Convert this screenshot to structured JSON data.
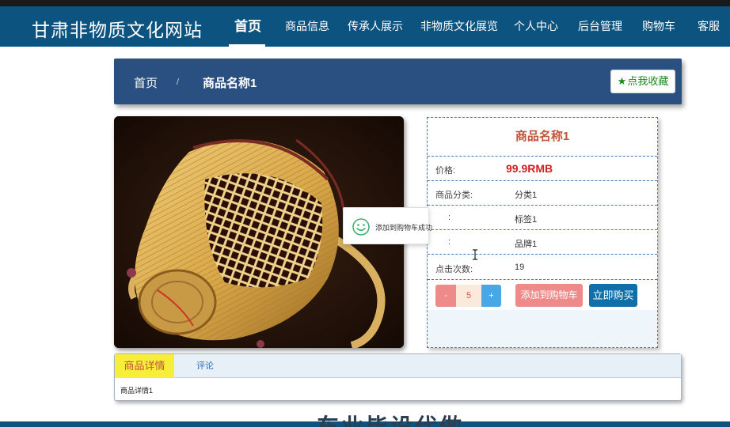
{
  "site": {
    "title": "甘肃非物质文化网站"
  },
  "nav": {
    "items": [
      {
        "label": "首页",
        "active": true
      },
      {
        "label": "商品信息"
      },
      {
        "label": "传承人展示"
      },
      {
        "label": "非物质文化展览"
      },
      {
        "label": "个人中心"
      },
      {
        "label": "后台管理"
      },
      {
        "label": "购物车"
      },
      {
        "label": "客服"
      }
    ]
  },
  "breadcrumb": {
    "home": "首页",
    "separator": "/",
    "current": "商品名称1"
  },
  "favorite": {
    "label": "点我收藏",
    "icon": "star-icon",
    "color": "#1a8a1a"
  },
  "product": {
    "name": "商品名称1",
    "price_label": "价格:",
    "price": "99.9RMB",
    "rows": [
      {
        "label": "商品分类:",
        "value": "分类1"
      },
      {
        "label": ":",
        "value": "标签1"
      },
      {
        "label": ":",
        "value": "品牌1"
      },
      {
        "label": "点击次数:",
        "value": "19"
      }
    ]
  },
  "quantity": {
    "minus": "-",
    "value": "5",
    "plus": "+"
  },
  "actions": {
    "add_to_cart": "添加到购物车",
    "buy_now": "立即购买"
  },
  "toast": {
    "message": "添加到购物车成功",
    "icon": "smile-icon"
  },
  "tabs": [
    {
      "label": "商品详情",
      "active": true
    },
    {
      "label": "评论"
    }
  ],
  "details": {
    "text": "商品详情1"
  },
  "overlay": {
    "text": "车业毕设代做"
  },
  "colors": {
    "navbar": "#0c5380",
    "breadcrumb_bar": "#2a5082",
    "price": "#cc2222",
    "accent_red": "#c0563a",
    "tab_active": "#f7ee3a",
    "cart_button": "#ee8a8a",
    "buy_button": "#106fa9"
  }
}
